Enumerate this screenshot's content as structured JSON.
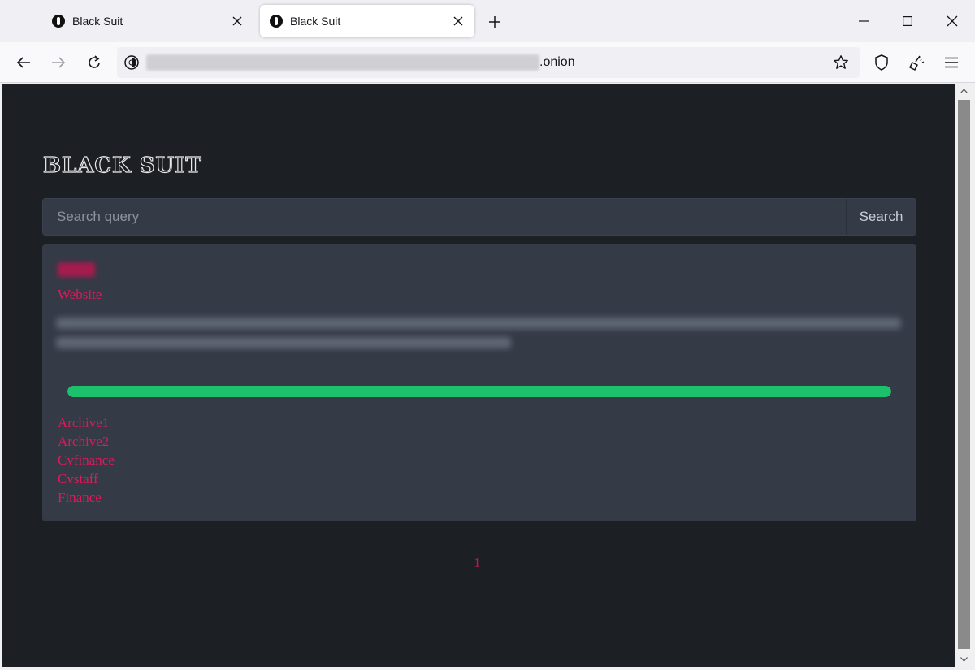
{
  "browser": {
    "tabs": [
      {
        "title": "Black Suit",
        "active": false
      },
      {
        "title": "Black Suit",
        "active": true
      }
    ],
    "url_suffix": ".onion"
  },
  "page": {
    "site_title": "BLACK SUIT",
    "search": {
      "placeholder": "Search query",
      "button_label": "Search"
    },
    "entry": {
      "website_label": "Website",
      "progress_percent": 100,
      "archives": [
        "Archive1",
        "Archive2",
        "Cvfinance",
        "Cvstaff",
        "Finance"
      ]
    },
    "pagination": {
      "current_page": "1"
    }
  },
  "colors": {
    "accent": "#e0195a",
    "progress": "#1cc26b",
    "page_bg": "#1c1f24",
    "card_bg": "#343a46"
  }
}
